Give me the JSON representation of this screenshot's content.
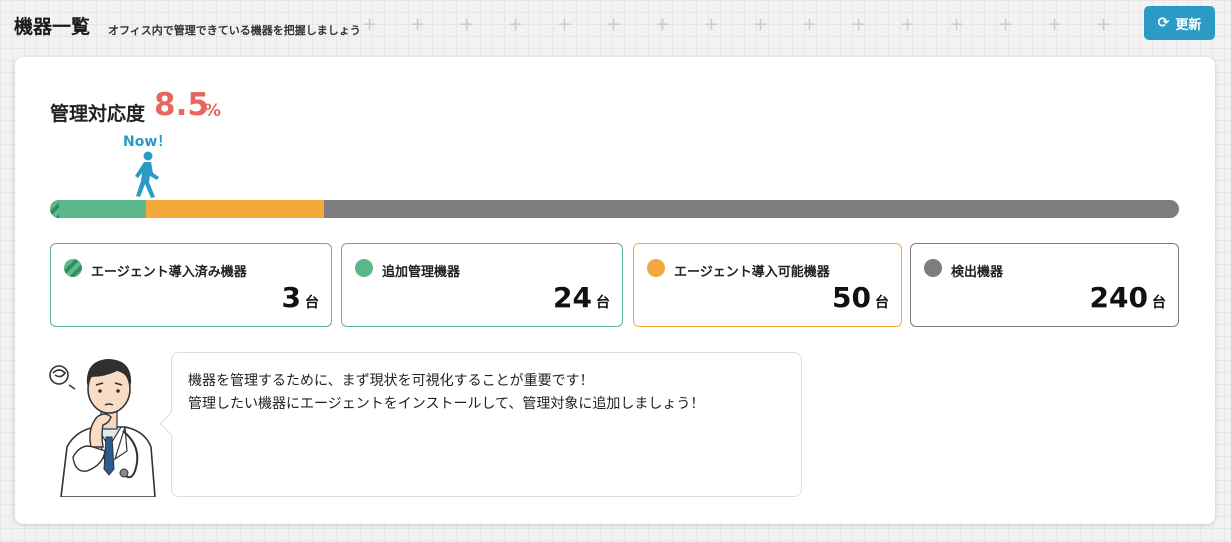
{
  "header": {
    "title": "機器一覧",
    "subtitle": "オフィス内で管理できている機器を把握しましょう",
    "refresh_label": "更新",
    "refresh_icon": "refresh-icon"
  },
  "management_rate": {
    "label": "管理対応度",
    "value": "8.5",
    "unit": "%",
    "current_marker": "Now！",
    "marker_icon": "walking-person-icon"
  },
  "progress": {
    "installed_fraction": 0.008,
    "added_fraction": 0.077,
    "possible_fraction": 0.158,
    "total": 317
  },
  "stats": [
    {
      "label": "エージェント導入済み機器",
      "value": "3",
      "unit": "台",
      "color": "#3a9a6a",
      "icon": "striped-green-dot-icon"
    },
    {
      "label": "追加管理機器",
      "value": "24",
      "unit": "台",
      "color": "#5cb88a",
      "icon": "green-dot-icon"
    },
    {
      "label": "エージェント導入可能機器",
      "value": "50",
      "unit": "台",
      "color": "#f5a93d",
      "icon": "orange-dot-icon"
    },
    {
      "label": "検出機器",
      "value": "240",
      "unit": "台",
      "color": "#7d7d7d",
      "icon": "gray-dot-icon"
    }
  ],
  "advice": {
    "line1": "機器を管理するために、まず現状を可視化することが重要です！",
    "line2": "管理したい機器にエージェントをインストールして、管理対象に追加しましょう！",
    "illustration": "thinking-doctor-illustration"
  },
  "colors": {
    "accent": "#2a9bc4",
    "rate": "#e8675c"
  }
}
